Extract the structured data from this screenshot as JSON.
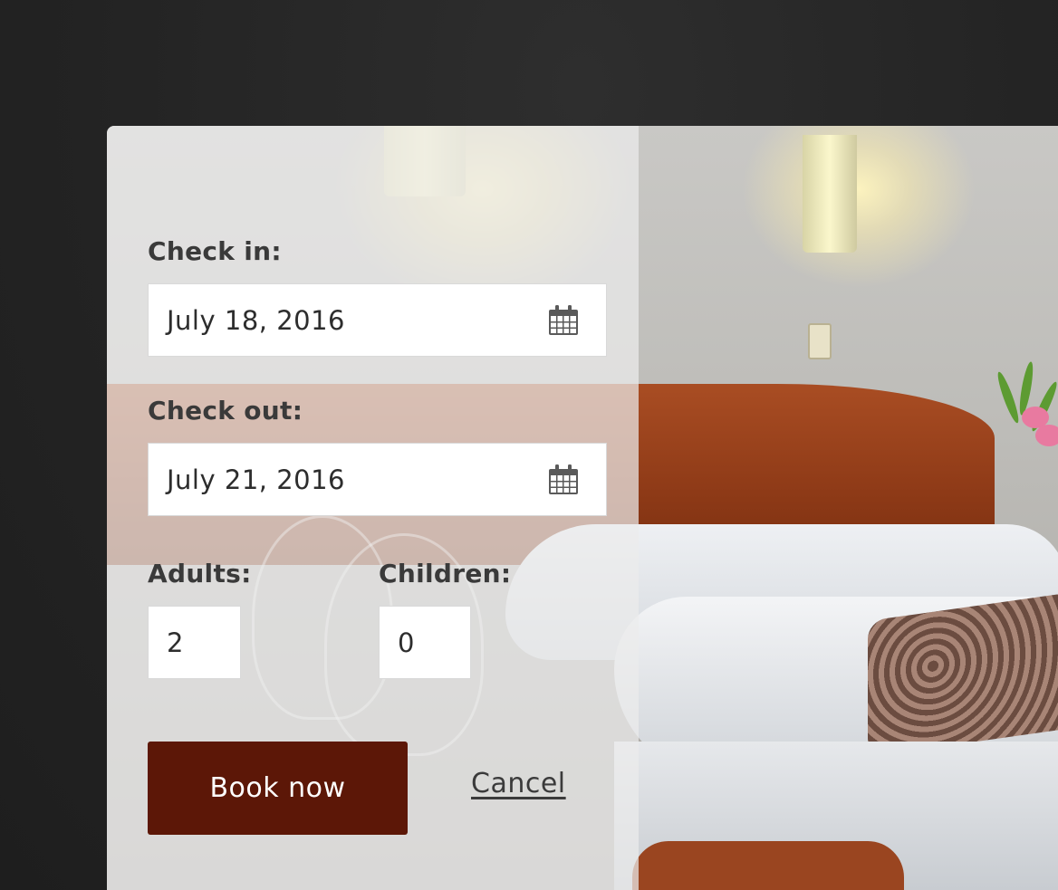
{
  "form": {
    "check_in": {
      "label": "Check in:",
      "value": "July 18, 2016",
      "icon": "calendar-icon"
    },
    "check_out": {
      "label": "Check out:",
      "value": "July 21, 2016",
      "icon": "calendar-icon"
    },
    "adults": {
      "label": "Adults:",
      "value": "2"
    },
    "children": {
      "label": "Children:",
      "value": "0"
    },
    "book_label": "Book now",
    "cancel_label": "Cancel"
  },
  "colors": {
    "background": "#262626",
    "panel_overlay": "rgba(235,235,235,0.72)",
    "book_button": "#5c1707",
    "label_text": "#3a3a3a"
  }
}
